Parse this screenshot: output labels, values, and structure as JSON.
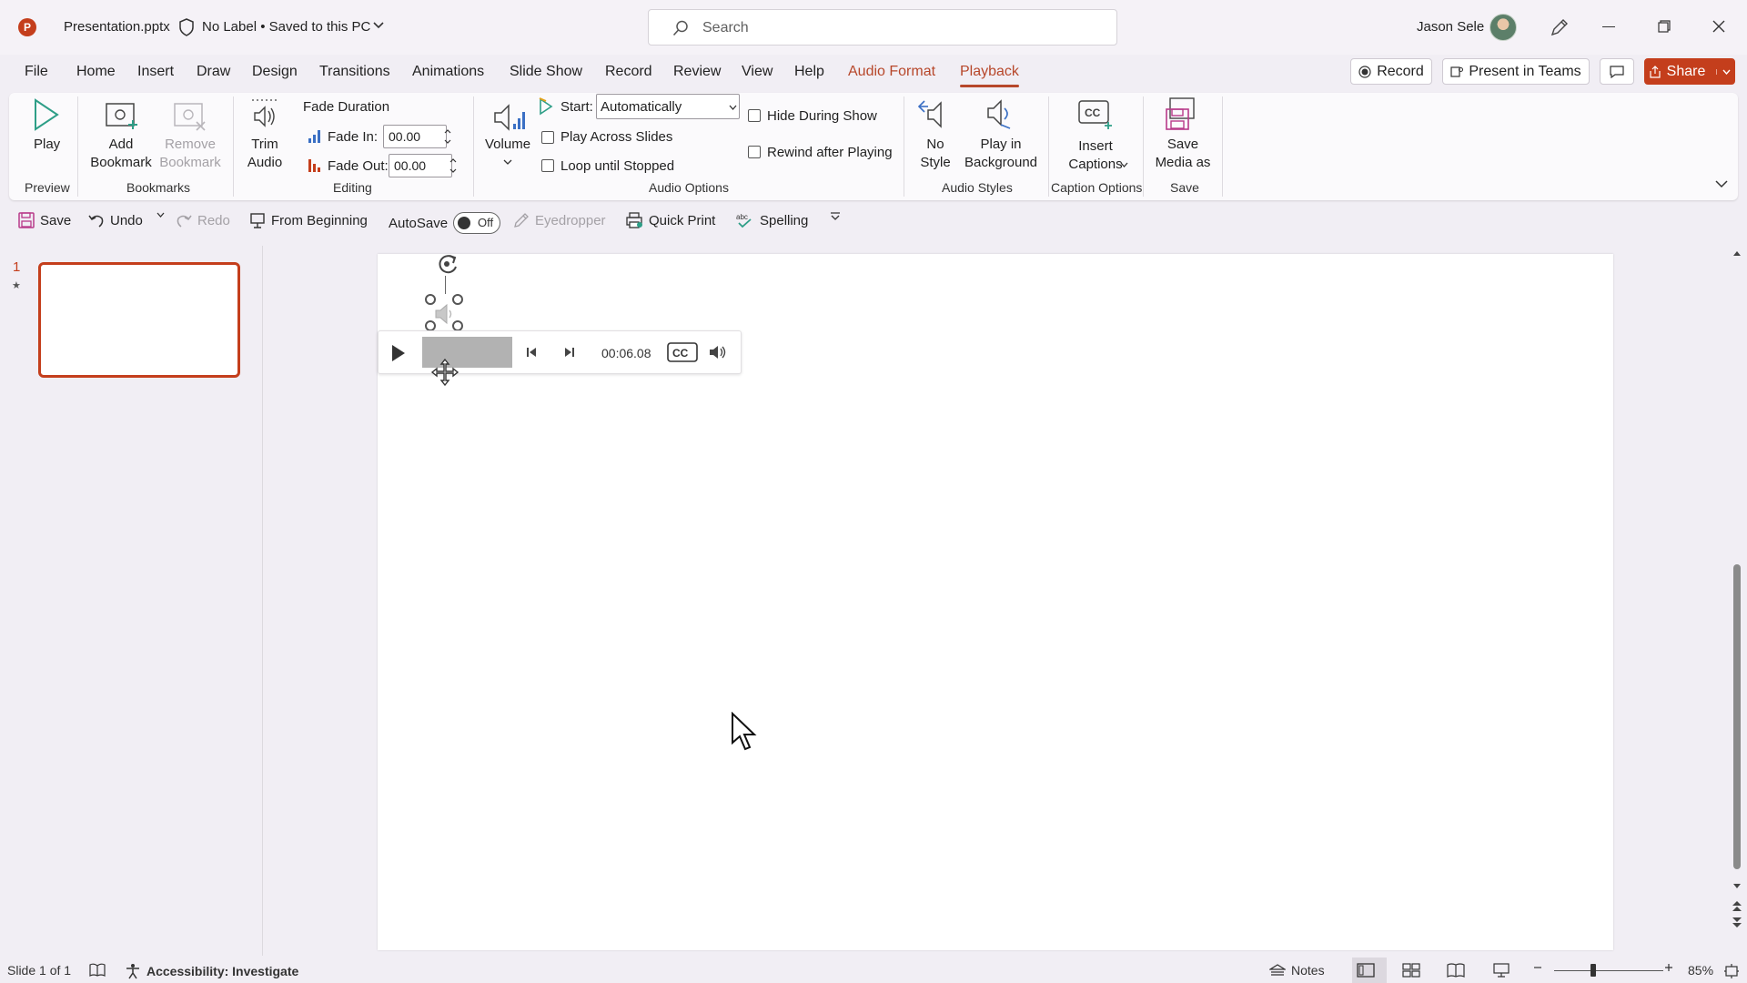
{
  "titlebar": {
    "file_name": "Presentation.pptx",
    "label_status": "No Label • Saved to this PC",
    "search_placeholder": "Search",
    "user_name": "Jason Sele"
  },
  "tabs": [
    "File",
    "Home",
    "Insert",
    "Draw",
    "Design",
    "Transitions",
    "Animations",
    "Slide Show",
    "Record",
    "Review",
    "View",
    "Help",
    "Audio Format",
    "Playback"
  ],
  "active_tab": "Playback",
  "header_buttons": {
    "record": "Record",
    "present_in_teams": "Present in Teams",
    "share": "Share"
  },
  "ribbon": {
    "preview": {
      "play": "Play",
      "group": "Preview"
    },
    "bookmarks": {
      "add_line1": "Add",
      "add_line2": "Bookmark",
      "remove_line1": "Remove",
      "remove_line2": "Bookmark",
      "group": "Bookmarks"
    },
    "editing": {
      "trim_line1": "Trim",
      "trim_line2": "Audio",
      "fade_duration": "Fade Duration",
      "fade_in_label": "Fade In:",
      "fade_in_value": "00.00",
      "fade_out_label": "Fade Out:",
      "fade_out_value": "00.00",
      "group": "Editing"
    },
    "audio_options": {
      "volume": "Volume",
      "start_label": "Start:",
      "start_value": "Automatically",
      "play_across_slides": "Play Across Slides",
      "loop_until_stopped": "Loop until Stopped",
      "hide_during_show": "Hide During Show",
      "rewind_after_playing": "Rewind after Playing",
      "group": "Audio Options"
    },
    "audio_styles": {
      "no_style_line1": "No",
      "no_style_line2": "Style",
      "play_bg_line1": "Play in",
      "play_bg_line2": "Background",
      "group": "Audio Styles"
    },
    "caption_options": {
      "insert_line1": "Insert",
      "insert_line2": "Captions",
      "group": "Caption Options"
    },
    "save": {
      "save_media_line1": "Save",
      "save_media_line2": "Media as",
      "group": "Save"
    }
  },
  "qat": {
    "save": "Save",
    "undo": "Undo",
    "redo": "Redo",
    "from_beginning": "From Beginning",
    "autosave": "AutoSave",
    "autosave_state": "Off",
    "eyedropper": "Eyedropper",
    "quick_print": "Quick Print",
    "spelling": "Spelling"
  },
  "thumbnails": {
    "slide_number": "1"
  },
  "media_player": {
    "time": "00:06.08"
  },
  "statusbar": {
    "slide_info": "Slide 1 of 1",
    "accessibility": "Accessibility: Investigate",
    "notes": "Notes",
    "zoom": "85%"
  },
  "colors": {
    "accent": "#c43e1c",
    "context_tab": "#b7472a"
  }
}
